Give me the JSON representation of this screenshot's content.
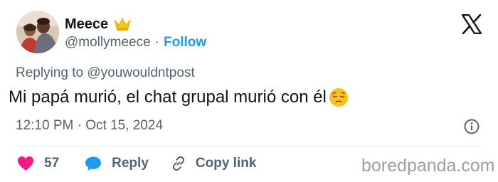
{
  "author": {
    "display_name": "Meece",
    "handle": "@mollymeece",
    "separator": "·",
    "follow_label": "Follow",
    "badge_icon": "crown-icon",
    "avatar_icon": "avatar"
  },
  "platform": {
    "logo_icon": "x-logo-icon"
  },
  "tweet": {
    "replying_prefix": "Replying to",
    "replying_mention": "@youwouldntpost",
    "text": "Mi papá murió, el chat grupal murió con él",
    "emoji_icon": "pensive-face-emoji",
    "timestamp": "12:10 PM · Oct 15, 2024",
    "info_icon": "info-icon"
  },
  "actions": {
    "like_count": "57",
    "like_icon": "heart-icon",
    "reply_label": "Reply",
    "reply_icon": "speech-bubble-icon",
    "copy_label": "Copy link",
    "copy_icon": "link-icon"
  },
  "watermark": {
    "text": "boredpanda.com"
  },
  "colors": {
    "accent": "#1d9bf0",
    "text": "#0f1419",
    "muted": "#536471",
    "like": "#f91880",
    "divider": "#e6ecf0",
    "watermark": "#9aa0a6"
  }
}
